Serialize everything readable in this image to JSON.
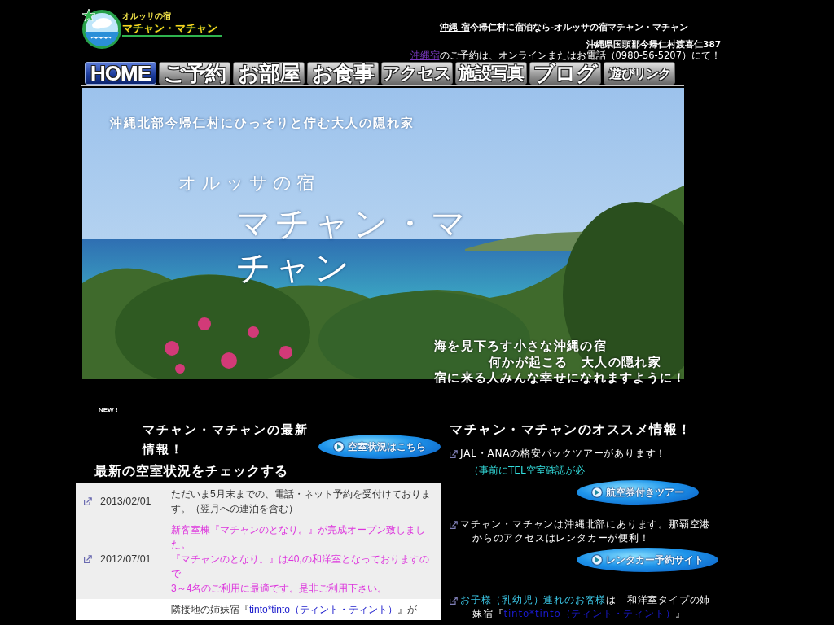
{
  "logo": {
    "tagline": "オルッサの宿",
    "name": "マチャン・マチャン"
  },
  "header": {
    "title_link": "沖縄 宿",
    "title_rest": "今帰仁村に宿泊なら-オルッサの宿マチャン・マチャン",
    "address": "沖縄県国頭郡今帰仁村渡喜仁387",
    "reservation_link": "沖縄宿",
    "reservation_rest": "のご予約は、オンラインまたはお電話（0980-56-5207）にて！"
  },
  "nav": [
    {
      "label": "HOME",
      "selected": true
    },
    {
      "label": "ご予約",
      "selected": false
    },
    {
      "label": "お部屋",
      "selected": false
    },
    {
      "label": "お食事",
      "selected": false
    },
    {
      "label": "アクセス",
      "selected": false
    },
    {
      "label": "施設写真",
      "selected": false
    },
    {
      "label": "ブログ",
      "selected": false
    },
    {
      "label": "遊びリンク",
      "selected": false
    }
  ],
  "hero": {
    "kicker": "沖縄北部今帰仁村にひっそりと佇む大人の隠れ家",
    "subtitle": "オルッサの宿",
    "title": "マチャン・マチャン",
    "tagline_lines": [
      "海を見下ろす小さな沖縄の宿",
      "何かが起こる　大人の隠れ家",
      "宿に来る人みんな幸せになれますように！"
    ]
  },
  "news": {
    "badge": "NEW !",
    "title": "マチャン・マチャンの最新情報！",
    "availability_heading": "最新の空室状況をチェックする",
    "availability_button": "空室状況はこちら",
    "rows": [
      {
        "date": "2013/02/01",
        "shaded": true,
        "color": "#333333",
        "paragraphs": [
          {
            "segments": [
              {
                "kind": "text",
                "text": "ただいま5月末までの、電話・ネット予約を受付けております。（翌月への連泊を含む）"
              }
            ]
          }
        ]
      },
      {
        "date": "2012/07/01",
        "shaded": true,
        "color": "#dd33dd",
        "paragraphs": [
          {
            "segments": [
              {
                "kind": "text",
                "text": "新客室棟『マチャンのとなり。』が完成オープン致しました。"
              }
            ]
          },
          {
            "segments": [
              {
                "kind": "text",
                "text": "『マチャンのとなり。』は40,の和洋室となっておりますので"
              }
            ]
          },
          {
            "segments": [
              {
                "kind": "text",
                "text": "3～4名のご利用に最適です。是非ご利用下さい。"
              }
            ]
          }
        ]
      },
      {
        "shaded": false,
        "paragraphs": [
          {
            "segments": [
              {
                "kind": "text",
                "text": "隣接地の姉妹宿『"
              },
              {
                "kind": "link",
                "text": "tinto*tinto（ティント・ティント）"
              },
              {
                "kind": "text",
                "text": "』が"
              }
            ]
          }
        ]
      }
    ]
  },
  "recommendations": {
    "title": "マチャン・マチャンのオススメ情報！",
    "items": [
      {
        "segments": [
          {
            "kind": "text",
            "text": "JAL・ANAの格安パックツアーがあります！"
          }
        ],
        "note": "（事前にTEL空室確認が必",
        "button": "航空券付きツアー"
      },
      {
        "segments": [
          {
            "kind": "text",
            "text": "マチャン・マチャンは沖縄北部にあります。那覇空港からのアクセスはレンタカーが便利！"
          }
        ],
        "button": "レンタカー予約サイト"
      },
      {
        "segments": [
          {
            "kind": "accent",
            "text": "お子様（乳幼児）連れのお客様"
          },
          {
            "kind": "text",
            "text": "は　和洋室タイプの姉妹宿『"
          },
          {
            "kind": "link",
            "text": "tinto*tinto（ティント・ティント）"
          },
          {
            "kind": "text",
            "text": "』"
          }
        ]
      }
    ]
  }
}
